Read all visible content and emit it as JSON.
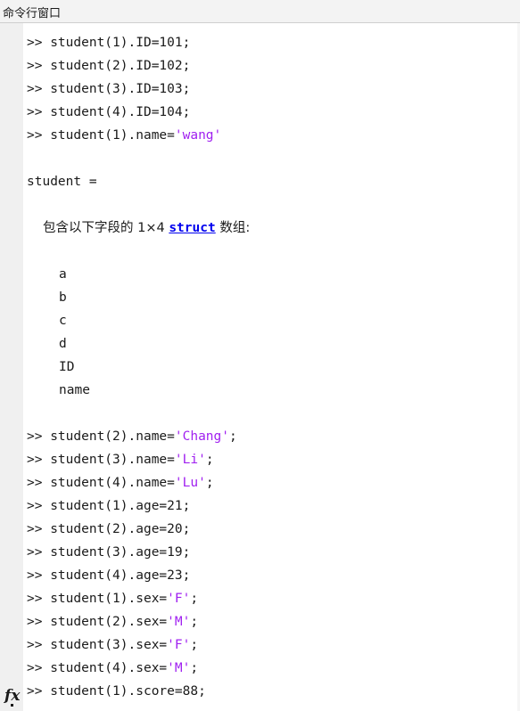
{
  "window": {
    "title": "命令行窗口"
  },
  "prompt": ">> ",
  "lines": [
    {
      "kind": "cmd",
      "code": "student(1).ID=101;"
    },
    {
      "kind": "cmd",
      "code": "student(2).ID=102;"
    },
    {
      "kind": "cmd",
      "code": "student(3).ID=103;"
    },
    {
      "kind": "cmd",
      "code": "student(4).ID=104;"
    },
    {
      "kind": "cmd",
      "code": "student(1).name=",
      "str": "'wang'",
      "tail": ""
    },
    {
      "kind": "blank"
    },
    {
      "kind": "out",
      "text": "student ="
    },
    {
      "kind": "blank"
    },
    {
      "kind": "struct",
      "pre": "包含以下字段的 1×4 ",
      "link": "struct",
      "post": " 数组:"
    },
    {
      "kind": "blank"
    },
    {
      "kind": "field",
      "text": "a"
    },
    {
      "kind": "field",
      "text": "b"
    },
    {
      "kind": "field",
      "text": "c"
    },
    {
      "kind": "field",
      "text": "d"
    },
    {
      "kind": "field",
      "text": "ID"
    },
    {
      "kind": "field",
      "text": "name"
    },
    {
      "kind": "blank"
    },
    {
      "kind": "cmd",
      "code": "student(2).name=",
      "str": "'Chang'",
      "tail": ";"
    },
    {
      "kind": "cmd",
      "code": "student(3).name=",
      "str": "'Li'",
      "tail": ";"
    },
    {
      "kind": "cmd",
      "code": "student(4).name=",
      "str": "'Lu'",
      "tail": ";"
    },
    {
      "kind": "cmd",
      "code": "student(1).age=21;"
    },
    {
      "kind": "cmd",
      "code": "student(2).age=20;"
    },
    {
      "kind": "cmd",
      "code": "student(3).age=19;"
    },
    {
      "kind": "cmd",
      "code": "student(4).age=23;"
    },
    {
      "kind": "cmd",
      "code": "student(1).sex=",
      "str": "'F'",
      "tail": ";"
    },
    {
      "kind": "cmd",
      "code": "student(2).sex=",
      "str": "'M'",
      "tail": ";"
    },
    {
      "kind": "cmd",
      "code": "student(3).sex=",
      "str": "'F'",
      "tail": ";"
    },
    {
      "kind": "cmd",
      "code": "student(4).sex=",
      "str": "'M'",
      "tail": ";"
    },
    {
      "kind": "cmd",
      "code": "student(1).score=88;"
    }
  ],
  "colors": {
    "string": "#a020f0",
    "link": "#0000ee"
  },
  "fx_icon": "fx-icon"
}
